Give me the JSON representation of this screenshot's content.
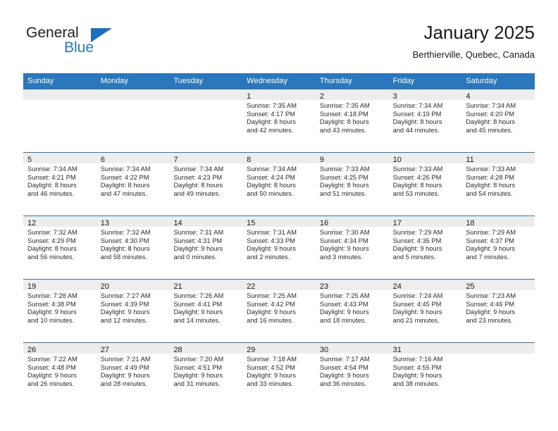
{
  "logo": {
    "word_top": "General",
    "word_bottom": "Blue",
    "triangle_color": "#1b6ec2",
    "blue_text_color": "#1b7fd4"
  },
  "header": {
    "title": "January 2025",
    "subtitle": "Berthierville, Quebec, Canada"
  },
  "theme": {
    "header_bar": "#2b77bd",
    "day_band": "#ededed",
    "row_divider": "#2b77bd",
    "text": "#1a1a1a"
  },
  "weekday_headers": [
    "Sunday",
    "Monday",
    "Tuesday",
    "Wednesday",
    "Thursday",
    "Friday",
    "Saturday"
  ],
  "weeks": [
    [
      {
        "day": "",
        "lines": []
      },
      {
        "day": "",
        "lines": []
      },
      {
        "day": "",
        "lines": []
      },
      {
        "day": "1",
        "lines": [
          "Sunrise: 7:35 AM",
          "Sunset: 4:17 PM",
          "Daylight: 8 hours",
          "and 42 minutes."
        ]
      },
      {
        "day": "2",
        "lines": [
          "Sunrise: 7:35 AM",
          "Sunset: 4:18 PM",
          "Daylight: 8 hours",
          "and 43 minutes."
        ]
      },
      {
        "day": "3",
        "lines": [
          "Sunrise: 7:34 AM",
          "Sunset: 4:19 PM",
          "Daylight: 8 hours",
          "and 44 minutes."
        ]
      },
      {
        "day": "4",
        "lines": [
          "Sunrise: 7:34 AM",
          "Sunset: 4:20 PM",
          "Daylight: 8 hours",
          "and 45 minutes."
        ]
      }
    ],
    [
      {
        "day": "5",
        "lines": [
          "Sunrise: 7:34 AM",
          "Sunset: 4:21 PM",
          "Daylight: 8 hours",
          "and 46 minutes."
        ]
      },
      {
        "day": "6",
        "lines": [
          "Sunrise: 7:34 AM",
          "Sunset: 4:22 PM",
          "Daylight: 8 hours",
          "and 47 minutes."
        ]
      },
      {
        "day": "7",
        "lines": [
          "Sunrise: 7:34 AM",
          "Sunset: 4:23 PM",
          "Daylight: 8 hours",
          "and 49 minutes."
        ]
      },
      {
        "day": "8",
        "lines": [
          "Sunrise: 7:34 AM",
          "Sunset: 4:24 PM",
          "Daylight: 8 hours",
          "and 50 minutes."
        ]
      },
      {
        "day": "9",
        "lines": [
          "Sunrise: 7:33 AM",
          "Sunset: 4:25 PM",
          "Daylight: 8 hours",
          "and 51 minutes."
        ]
      },
      {
        "day": "10",
        "lines": [
          "Sunrise: 7:33 AM",
          "Sunset: 4:26 PM",
          "Daylight: 8 hours",
          "and 53 minutes."
        ]
      },
      {
        "day": "11",
        "lines": [
          "Sunrise: 7:33 AM",
          "Sunset: 4:28 PM",
          "Daylight: 8 hours",
          "and 54 minutes."
        ]
      }
    ],
    [
      {
        "day": "12",
        "lines": [
          "Sunrise: 7:32 AM",
          "Sunset: 4:29 PM",
          "Daylight: 8 hours",
          "and 56 minutes."
        ]
      },
      {
        "day": "13",
        "lines": [
          "Sunrise: 7:32 AM",
          "Sunset: 4:30 PM",
          "Daylight: 8 hours",
          "and 58 minutes."
        ]
      },
      {
        "day": "14",
        "lines": [
          "Sunrise: 7:31 AM",
          "Sunset: 4:31 PM",
          "Daylight: 9 hours",
          "and 0 minutes."
        ]
      },
      {
        "day": "15",
        "lines": [
          "Sunrise: 7:31 AM",
          "Sunset: 4:33 PM",
          "Daylight: 9 hours",
          "and 2 minutes."
        ]
      },
      {
        "day": "16",
        "lines": [
          "Sunrise: 7:30 AM",
          "Sunset: 4:34 PM",
          "Daylight: 9 hours",
          "and 3 minutes."
        ]
      },
      {
        "day": "17",
        "lines": [
          "Sunrise: 7:29 AM",
          "Sunset: 4:35 PM",
          "Daylight: 9 hours",
          "and 5 minutes."
        ]
      },
      {
        "day": "18",
        "lines": [
          "Sunrise: 7:29 AM",
          "Sunset: 4:37 PM",
          "Daylight: 9 hours",
          "and 7 minutes."
        ]
      }
    ],
    [
      {
        "day": "19",
        "lines": [
          "Sunrise: 7:28 AM",
          "Sunset: 4:38 PM",
          "Daylight: 9 hours",
          "and 10 minutes."
        ]
      },
      {
        "day": "20",
        "lines": [
          "Sunrise: 7:27 AM",
          "Sunset: 4:39 PM",
          "Daylight: 9 hours",
          "and 12 minutes."
        ]
      },
      {
        "day": "21",
        "lines": [
          "Sunrise: 7:26 AM",
          "Sunset: 4:41 PM",
          "Daylight: 9 hours",
          "and 14 minutes."
        ]
      },
      {
        "day": "22",
        "lines": [
          "Sunrise: 7:25 AM",
          "Sunset: 4:42 PM",
          "Daylight: 9 hours",
          "and 16 minutes."
        ]
      },
      {
        "day": "23",
        "lines": [
          "Sunrise: 7:25 AM",
          "Sunset: 4:43 PM",
          "Daylight: 9 hours",
          "and 18 minutes."
        ]
      },
      {
        "day": "24",
        "lines": [
          "Sunrise: 7:24 AM",
          "Sunset: 4:45 PM",
          "Daylight: 9 hours",
          "and 21 minutes."
        ]
      },
      {
        "day": "25",
        "lines": [
          "Sunrise: 7:23 AM",
          "Sunset: 4:46 PM",
          "Daylight: 9 hours",
          "and 23 minutes."
        ]
      }
    ],
    [
      {
        "day": "26",
        "lines": [
          "Sunrise: 7:22 AM",
          "Sunset: 4:48 PM",
          "Daylight: 9 hours",
          "and 26 minutes."
        ]
      },
      {
        "day": "27",
        "lines": [
          "Sunrise: 7:21 AM",
          "Sunset: 4:49 PM",
          "Daylight: 9 hours",
          "and 28 minutes."
        ]
      },
      {
        "day": "28",
        "lines": [
          "Sunrise: 7:20 AM",
          "Sunset: 4:51 PM",
          "Daylight: 9 hours",
          "and 31 minutes."
        ]
      },
      {
        "day": "29",
        "lines": [
          "Sunrise: 7:18 AM",
          "Sunset: 4:52 PM",
          "Daylight: 9 hours",
          "and 33 minutes."
        ]
      },
      {
        "day": "30",
        "lines": [
          "Sunrise: 7:17 AM",
          "Sunset: 4:54 PM",
          "Daylight: 9 hours",
          "and 36 minutes."
        ]
      },
      {
        "day": "31",
        "lines": [
          "Sunrise: 7:16 AM",
          "Sunset: 4:55 PM",
          "Daylight: 9 hours",
          "and 38 minutes."
        ]
      },
      {
        "day": "",
        "lines": []
      }
    ]
  ]
}
